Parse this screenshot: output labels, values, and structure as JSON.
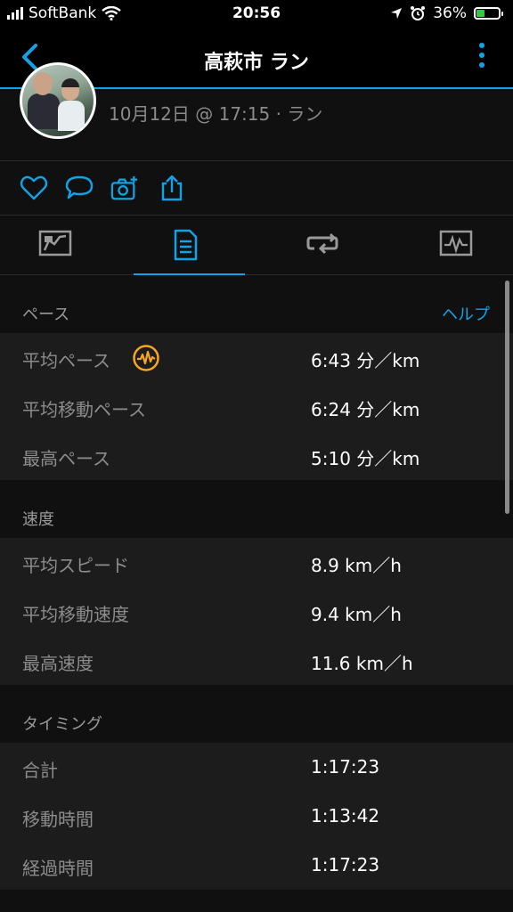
{
  "status_bar": {
    "carrier": "SoftBank",
    "time": "20:56",
    "battery": "36%",
    "signal_icon": "signal-bars-icon",
    "wifi_icon": "wifi-icon",
    "location_icon": "location-arrow-icon",
    "alarm_icon": "alarm-clock-icon",
    "battery_icon": "battery-charging-icon"
  },
  "nav": {
    "title": "高萩市 ラン",
    "back_icon": "chevron-left-icon",
    "more_icon": "vertical-dots-icon",
    "accent": "#12a3e6"
  },
  "header": {
    "date_line": "10月12日 @ 17:15 · ラン"
  },
  "actions": [
    "heart-icon",
    "comment-icon",
    "add-photo-icon",
    "share-icon"
  ],
  "tabs": [
    {
      "icon": "map-icon",
      "active": false
    },
    {
      "icon": "stats-list-icon",
      "active": true
    },
    {
      "icon": "laps-icon",
      "active": false
    },
    {
      "icon": "charts-icon",
      "active": false
    }
  ],
  "sections": {
    "pace": {
      "label": "ペース",
      "help": "ヘルプ",
      "rows": [
        {
          "label": "平均ペース",
          "value": "6:43 分／km"
        },
        {
          "label": "平均移動ペース",
          "value": "6:24 分／km"
        },
        {
          "label": "最高ペース",
          "value": "5:10 分／km"
        }
      ]
    },
    "speed": {
      "label": "速度",
      "rows": [
        {
          "label": "平均スピード",
          "value": "8.9 km／h"
        },
        {
          "label": "平均移動速度",
          "value": "9.4 km／h"
        },
        {
          "label": "最高速度",
          "value": "11.6 km／h"
        }
      ]
    },
    "timing": {
      "label": "タイミング",
      "rows": [
        {
          "label": "合計",
          "value": "1:17:23"
        },
        {
          "label": "移動時間",
          "value": "1:13:42"
        },
        {
          "label": "経過時間",
          "value": "1:17:23"
        }
      ]
    }
  }
}
